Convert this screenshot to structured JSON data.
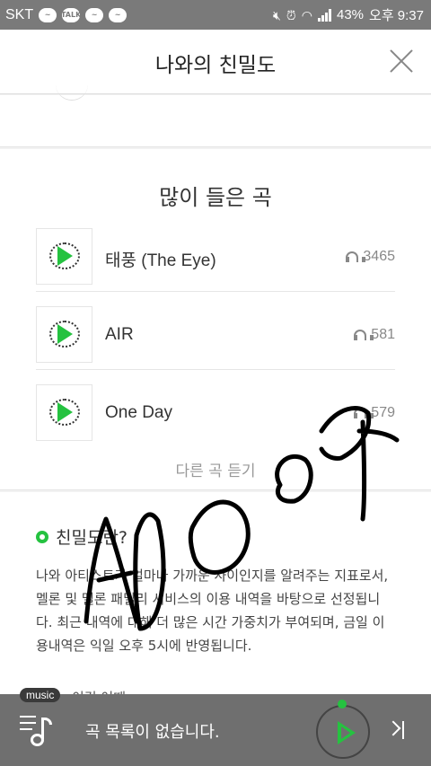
{
  "status_bar": {
    "carrier": "SKT",
    "talk_badge": "TALK",
    "battery": "43%",
    "time": "오후 9:37"
  },
  "header": {
    "title": "나와의 친밀도"
  },
  "top_songs": {
    "title": "많이 들은 곡",
    "items": [
      {
        "name": "태풍 (The Eye)",
        "plays": "3465"
      },
      {
        "name": "AIR",
        "plays": "581"
      },
      {
        "name": "One Day",
        "plays": "579"
      }
    ],
    "more_label": "다른 곡 듣기"
  },
  "about": {
    "title": "친밀도란?",
    "description": "나와 아티스트가 얼마나 가까운 사이인지를 알려주는 지표로서, 멜론 및 멜론 패밀리 서비스의 이용 내역을 바탕으로 선정됩니다. 최근 내역에 대해 더 많은 시간 가중치가 부여되며, 금일 이용내역은 익일 오후 5시에 반영됩니다.",
    "next_partial": "이건 어때"
  },
  "player": {
    "badge": "music",
    "status": "곡 목록이 없습니다."
  },
  "colors": {
    "accent": "#25c240",
    "player_bg": "#6f6f6f",
    "status_bg": "#7a7a7a"
  },
  "overlay": {
    "handwriting": "ADDOT"
  }
}
